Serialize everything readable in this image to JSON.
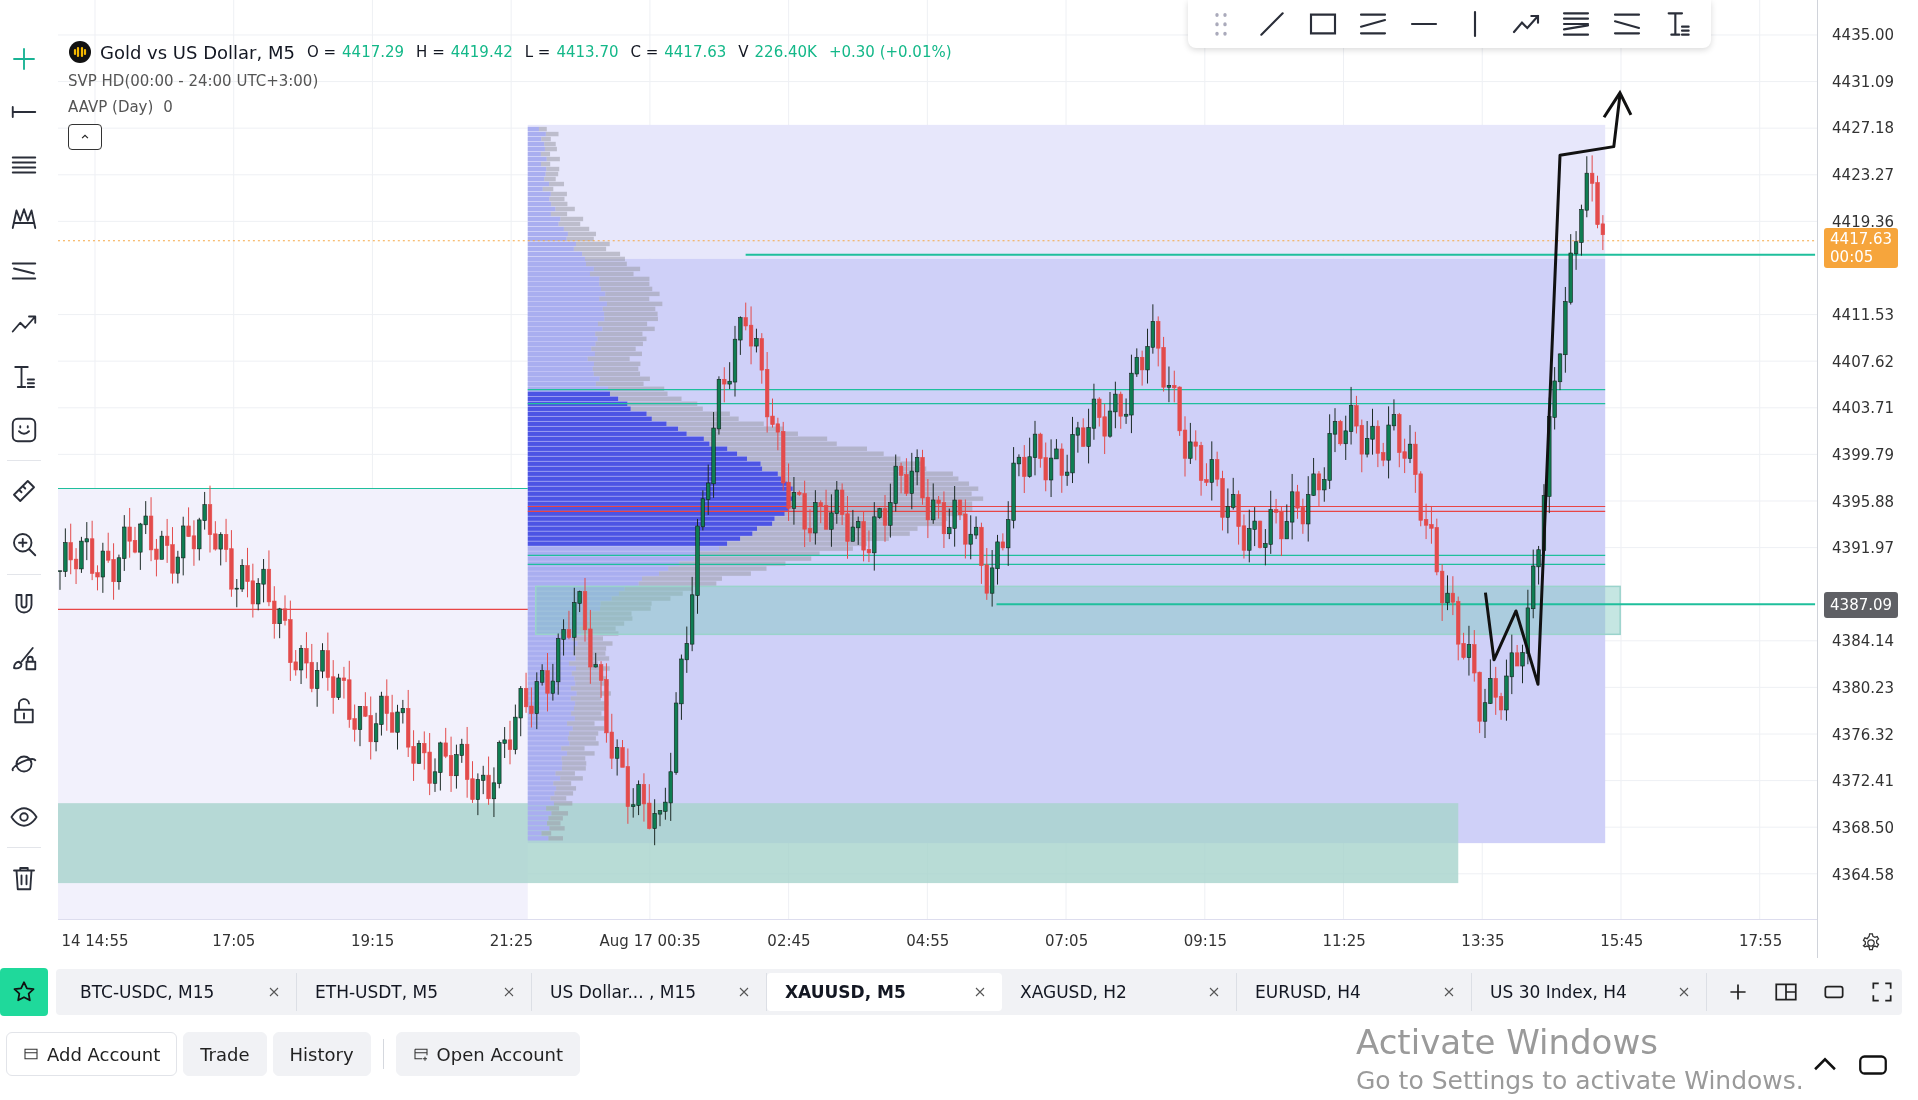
{
  "header": {
    "title": "Gold vs US Dollar, M5",
    "stats": [
      {
        "label": "O =",
        "value": "4417.29"
      },
      {
        "label": "H =",
        "value": "4419.42"
      },
      {
        "label": "L =",
        "value": "4413.70"
      },
      {
        "label": "C =",
        "value": "4417.63"
      },
      {
        "label": "V",
        "value": "226.40K"
      }
    ],
    "change": "+0.30 (+0.01%)"
  },
  "indicators": [
    {
      "name": "SVP HD(00:00 - 24:00 UTC+3:00)"
    },
    {
      "name": "AAVP (Day)",
      "value": "0"
    }
  ],
  "price_axis": {
    "ticks": [
      "4435.00",
      "4431.09",
      "4427.18",
      "4423.27",
      "4419.36",
      "4411.53",
      "4407.62",
      "4403.71",
      "4399.79",
      "4395.88",
      "4391.97",
      "4384.14",
      "4380.23",
      "4376.32",
      "4372.41",
      "4368.50",
      "4364.58"
    ],
    "last_price": {
      "price": "4417.63",
      "countdown": "00:05"
    },
    "marker": "4387.09"
  },
  "time_axis": {
    "ticks": [
      "14 14:55",
      "17:05",
      "19:15",
      "21:25",
      "Aug 17 00:35",
      "02:45",
      "04:55",
      "07:05",
      "09:15",
      "11:25",
      "13:35",
      "15:45",
      "17:55"
    ]
  },
  "tabs": [
    {
      "label": "BTC-USDC, M15",
      "selected": false
    },
    {
      "label": "ETH-USDT, M5",
      "selected": false
    },
    {
      "label": "US Dollar... , M15",
      "selected": false
    },
    {
      "label": "XAUUSD, M5",
      "selected": true
    },
    {
      "label": "XAGUSD, H2",
      "selected": false
    },
    {
      "label": "EURUSD, H4",
      "selected": false
    },
    {
      "label": "US 30 Index, H4",
      "selected": false
    }
  ],
  "account_bar": {
    "buttons": [
      {
        "label": "Add Account",
        "kind": "add"
      },
      {
        "label": "Trade",
        "kind": "plain"
      },
      {
        "label": "History",
        "kind": "plain"
      },
      {
        "label": "Open Account",
        "kind": "open"
      }
    ]
  },
  "os_notice": {
    "title": "Activate Windows",
    "text": "Go to Settings to activate Windows."
  }
}
